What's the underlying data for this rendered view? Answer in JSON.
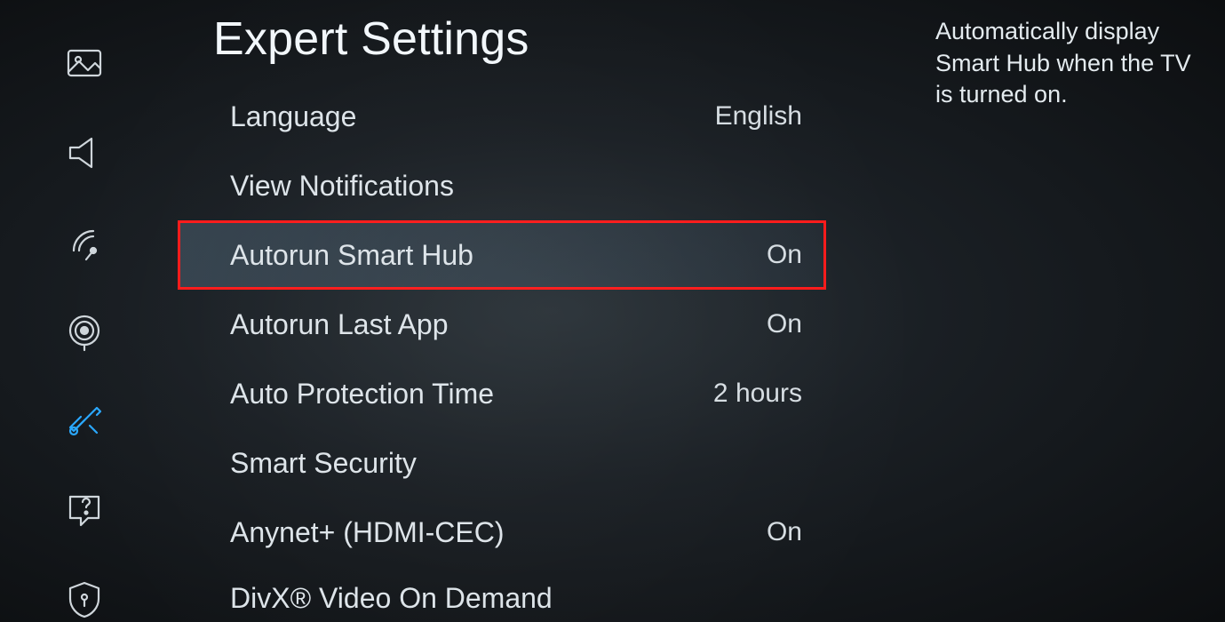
{
  "title": "Expert Settings",
  "help_text": "Automatically display Smart Hub when the TV is turned on.",
  "sidebar": {
    "items": [
      {
        "name": "picture-icon"
      },
      {
        "name": "sound-icon"
      },
      {
        "name": "broadcast-icon"
      },
      {
        "name": "network-icon"
      },
      {
        "name": "system-icon",
        "active": true
      },
      {
        "name": "support-icon"
      },
      {
        "name": "privacy-icon"
      }
    ]
  },
  "rows": [
    {
      "label": "Language",
      "value": "English"
    },
    {
      "label": "View Notifications",
      "value": ""
    },
    {
      "label": "Autorun Smart Hub",
      "value": "On",
      "selected": true
    },
    {
      "label": "Autorun Last App",
      "value": "On"
    },
    {
      "label": "Auto Protection Time",
      "value": "2 hours"
    },
    {
      "label": "Smart Security",
      "value": ""
    },
    {
      "label": "Anynet+ (HDMI-CEC)",
      "value": "On"
    },
    {
      "label": "DivX® Video On Demand",
      "value": ""
    }
  ]
}
